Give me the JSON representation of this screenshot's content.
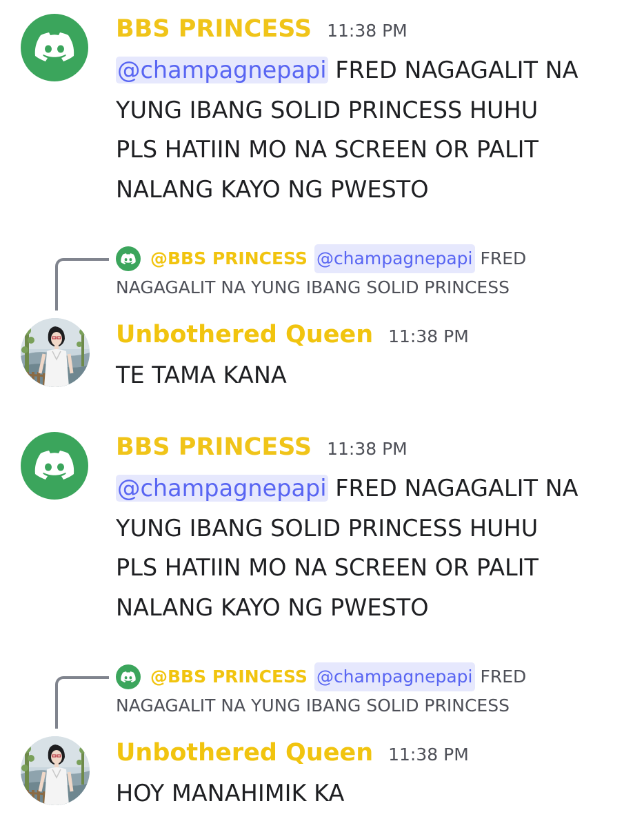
{
  "messages": [
    {
      "author": "BBS PRINCESS",
      "time": "11:38 PM",
      "mention": "@champagnepapi",
      "text_lines": [
        " FRED NAGAGALIT NA",
        "YUNG IBANG SOLID PRINCESS HUHU",
        "PLS HATIIN MO NA SCREEN OR PALIT",
        "NALANG KAYO NG PWESTO"
      ]
    },
    {
      "reply": {
        "author": "@BBS PRINCESS",
        "mention": "@champagnepapi",
        "text_line1": "FRED",
        "text_line2": "NAGAGALIT NA YUNG IBANG SOLID PRINCESS"
      },
      "author": "Unbothered Queen",
      "time": "11:38 PM",
      "text": "TE TAMA KANA"
    },
    {
      "author": "BBS PRINCESS",
      "time": "11:38 PM",
      "mention": "@champagnepapi",
      "text_lines": [
        " FRED NAGAGALIT NA",
        "YUNG IBANG SOLID PRINCESS HUHU",
        "PLS HATIIN MO NA SCREEN OR PALIT",
        "NALANG KAYO NG PWESTO"
      ]
    },
    {
      "reply": {
        "author": "@BBS PRINCESS",
        "mention": "@champagnepapi",
        "text_line1": "FRED",
        "text_line2": "NAGAGALIT NA YUNG IBANG SOLID PRINCESS"
      },
      "author": "Unbothered Queen",
      "time": "11:38 PM",
      "text": "HOY MANAHIMIK KA"
    }
  ],
  "colors": {
    "discord_green": "#3ba55c",
    "username_yellow": "#f1c40f",
    "mention_bg": "#e6e8fd",
    "mention_text": "#5865f2",
    "timestamp": "#4e5058"
  },
  "icons": {
    "princess_avatar": "discord-logo-icon",
    "queen_avatar": "user-avatar-photo"
  }
}
